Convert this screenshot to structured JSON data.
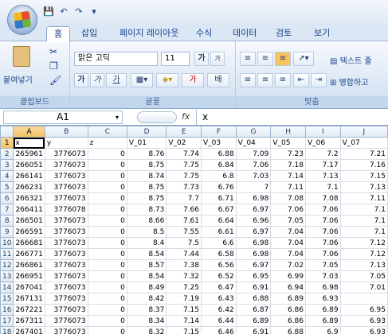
{
  "quick_access": {
    "save": "💾",
    "undo": "↶",
    "redo": "↷",
    "more": "▾"
  },
  "tabs": [
    "홈",
    "삽입",
    "페이지 레이아웃",
    "수식",
    "데이터",
    "검토",
    "보기"
  ],
  "clipboard": {
    "paste": "붙여넣기",
    "label": "클립보드"
  },
  "font": {
    "name": "맑은 고딕",
    "size": "11",
    "grow": "가",
    "shrink": "가",
    "bold": "가",
    "italic": "가",
    "underline": "가",
    "color": "가",
    "phonetic": "배",
    "label": "글꼴"
  },
  "alignment": {
    "wrap": "텍스트 줄",
    "merge": "병합하고",
    "label": "맞춤"
  },
  "formula_bar": {
    "name_box": "A1",
    "fx": "fx",
    "value": "x"
  },
  "columns": [
    "A",
    "B",
    "C",
    "D",
    "E",
    "F",
    "G",
    "H",
    "I",
    "J"
  ],
  "rows": [
    [
      "1",
      "x",
      "y",
      "z",
      "V_01",
      "V_02",
      "V_03",
      "V_04",
      "V_05",
      "V_06",
      "V_07"
    ],
    [
      "2",
      "265961",
      "3776073",
      "0",
      "8.76",
      "7.74",
      "6.88",
      "7.09",
      "7.23",
      "7.2",
      "7.21"
    ],
    [
      "3",
      "266051",
      "3776073",
      "0",
      "8.75",
      "7.75",
      "6.84",
      "7.06",
      "7.18",
      "7.17",
      "7.16"
    ],
    [
      "4",
      "266141",
      "3776073",
      "0",
      "8.74",
      "7.75",
      "6.8",
      "7.03",
      "7.14",
      "7.13",
      "7.15"
    ],
    [
      "5",
      "266231",
      "3776073",
      "0",
      "8.75",
      "7.73",
      "6.76",
      "7",
      "7.11",
      "7.1",
      "7.13"
    ],
    [
      "6",
      "266321",
      "3776073",
      "0",
      "8.75",
      "7.7",
      "6.71",
      "6.98",
      "7.08",
      "7.08",
      "7.11"
    ],
    [
      "7",
      "266411",
      "3776078",
      "0",
      "8.73",
      "7.66",
      "6.67",
      "6.97",
      "7.06",
      "7.06",
      "7.1"
    ],
    [
      "8",
      "266501",
      "3776073",
      "0",
      "8.66",
      "7.61",
      "6.64",
      "6.96",
      "7.05",
      "7.06",
      "7.1"
    ],
    [
      "9",
      "266591",
      "3776073",
      "0",
      "8.5",
      "7.55",
      "6.61",
      "6.97",
      "7.04",
      "7.06",
      "7.1"
    ],
    [
      "10",
      "266681",
      "3776073",
      "0",
      "8.4",
      "7.5",
      "6.6",
      "6.98",
      "7.04",
      "7.06",
      "7.12"
    ],
    [
      "11",
      "266771",
      "3776073",
      "0",
      "8.54",
      "7.44",
      "6.58",
      "6.98",
      "7.04",
      "7.06",
      "7.12"
    ],
    [
      "12",
      "266861",
      "3776073",
      "0",
      "8.57",
      "7.38",
      "6.56",
      "6.97",
      "7.02",
      "7.05",
      "7.13"
    ],
    [
      "13",
      "266951",
      "3776073",
      "0",
      "8.54",
      "7.32",
      "6.52",
      "6.95",
      "6.99",
      "7.03",
      "7.05"
    ],
    [
      "14",
      "267041",
      "3776073",
      "0",
      "8.49",
      "7.25",
      "6.47",
      "6.91",
      "6.94",
      "6.98",
      "7.01"
    ],
    [
      "15",
      "267131",
      "3776073",
      "0",
      "8.42",
      "7.19",
      "6.43",
      "6.88",
      "6.89",
      "6.93",
      ""
    ],
    [
      "16",
      "267221",
      "3776073",
      "0",
      "8.37",
      "7.15",
      "6.42",
      "6.87",
      "6.86",
      "6.89",
      "6.95"
    ],
    [
      "17",
      "267311",
      "3776073",
      "0",
      "8.34",
      "7.14",
      "6.44",
      "6.89",
      "6.86",
      "6.89",
      "6.93"
    ],
    [
      "18",
      "267401",
      "3776073",
      "0",
      "8.32",
      "7.15",
      "6.46",
      "6.91",
      "6.88",
      "6.9",
      "6.93"
    ],
    [
      "19",
      "267491",
      "3776073",
      "0",
      "8.32",
      "7.16",
      "6.48",
      "6.93",
      "6.9",
      "6.93",
      "6.98"
    ]
  ]
}
